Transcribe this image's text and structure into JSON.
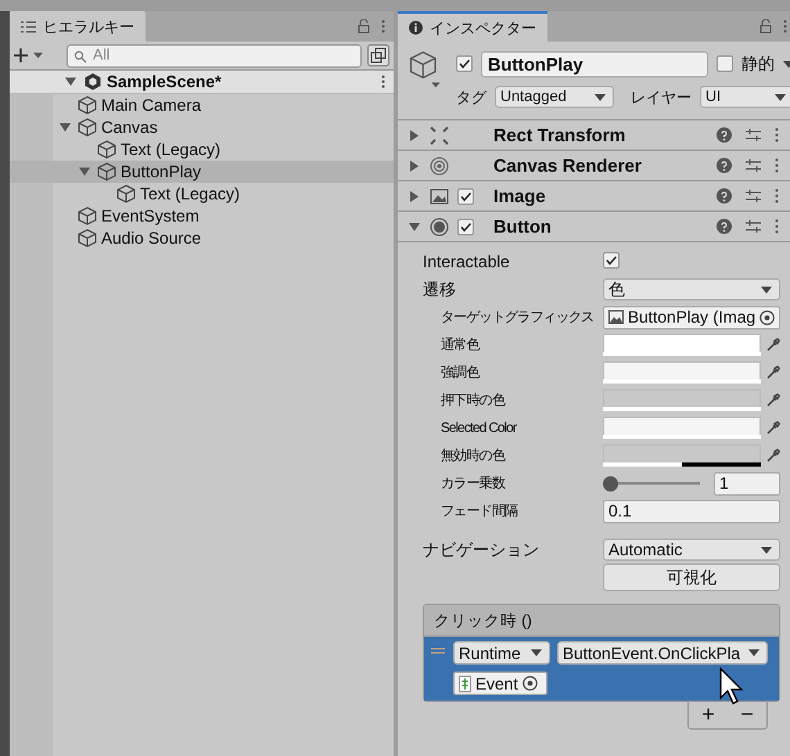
{
  "hierarchy": {
    "tab": "ヒエラルキー",
    "search": {
      "placeholder": "All"
    },
    "scene": {
      "name": "SampleScene*",
      "expanded": true
    },
    "items": [
      {
        "name": "Main Camera",
        "selected": false
      },
      {
        "name": "Canvas",
        "selected": false,
        "expanded": true,
        "children": [
          {
            "name": "Text (Legacy)",
            "selected": false
          },
          {
            "name": "ButtonPlay",
            "selected": true,
            "expanded": true,
            "children": [
              {
                "name": "Text (Legacy)",
                "selected": false
              }
            ]
          }
        ]
      },
      {
        "name": "EventSystem",
        "selected": false
      },
      {
        "name": "Audio Source",
        "selected": false
      }
    ]
  },
  "inspector": {
    "tab": "インスペクター",
    "object": {
      "active": true,
      "name": "ButtonPlay",
      "static": false,
      "static_label": "静的",
      "tag_label": "タグ",
      "tag": "Untagged",
      "layer_label": "レイヤー",
      "layer": "UI"
    },
    "components": [
      {
        "kind": "rect-transform",
        "name": "Rect Transform",
        "expanded": false
      },
      {
        "kind": "canvas-renderer",
        "name": "Canvas Renderer",
        "expanded": false
      },
      {
        "kind": "image",
        "name": "Image",
        "expanded": false,
        "enabled": true
      },
      {
        "kind": "button",
        "name": "Button",
        "expanded": true,
        "enabled": true
      }
    ],
    "properties": [
      {
        "kind": "checkbox",
        "label": "Interactable",
        "checked": true
      },
      {
        "kind": "dropdown",
        "label": "遷移",
        "value": "色"
      },
      {
        "kind": "object",
        "label": "ターゲットグラフィックス",
        "value": "ButtonPlay (Imag",
        "indented": true
      },
      {
        "kind": "color",
        "label": "通常色",
        "color": "#ffffff",
        "level": 1,
        "indented": true
      },
      {
        "kind": "color",
        "label": "強調色",
        "color": "#f5f5f5",
        "level": 1,
        "indented": true
      },
      {
        "kind": "color",
        "label": "押下時の色",
        "color": "#c8c8c8",
        "level": 1,
        "indented": true
      },
      {
        "kind": "color",
        "label": "Selected Color",
        "color": "#f5f5f5",
        "level": 1,
        "indented": true
      },
      {
        "kind": "color",
        "label": "無効時の色",
        "color": "#c8c8c8",
        "level": 0.5,
        "indented": true
      },
      {
        "kind": "slider",
        "label": "カラー乗数",
        "level": 0,
        "value": "1",
        "indented": true
      },
      {
        "kind": "number",
        "label": "フェード間隔",
        "value": "0.1",
        "indented": true
      },
      {
        "kind": "spacer"
      },
      {
        "kind": "dropdown",
        "label": "ナビゲーション",
        "value": "Automatic"
      },
      {
        "kind": "button",
        "label": "可視化"
      }
    ],
    "event": {
      "title": "クリック時 ()",
      "entries": [
        {
          "runtime": "Runtime",
          "function": "ButtonEvent.OnClickPla",
          "object": "Event",
          "selected": true
        }
      ],
      "add": "+",
      "remove": "−"
    }
  }
}
